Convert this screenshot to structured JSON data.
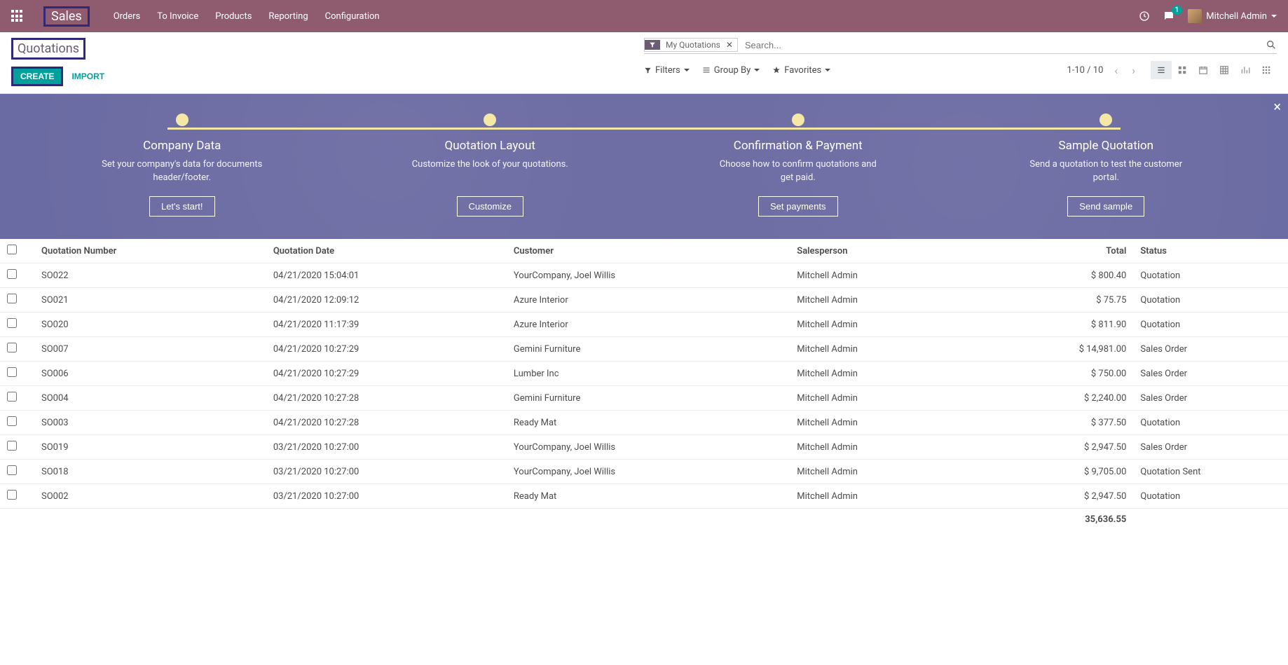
{
  "navbar": {
    "app_title": "Sales",
    "menu": [
      "Orders",
      "To Invoice",
      "Products",
      "Reporting",
      "Configuration"
    ],
    "messaging_badge": "1",
    "user_name": "Mitchell Admin"
  },
  "control_panel": {
    "breadcrumb": "Quotations",
    "create_label": "CREATE",
    "import_label": "IMPORT",
    "filter_chip": "My Quotations",
    "search_placeholder": "Search...",
    "filters_label": "Filters",
    "groupby_label": "Group By",
    "favorites_label": "Favorites",
    "pager_text": "1-10 / 10"
  },
  "onboarding": {
    "steps": [
      {
        "title": "Company Data",
        "desc": "Set your company's data for documents header/footer.",
        "button": "Let's start!"
      },
      {
        "title": "Quotation Layout",
        "desc": "Customize the look of your quotations.",
        "button": "Customize"
      },
      {
        "title": "Confirmation & Payment",
        "desc": "Choose how to confirm quotations and get paid.",
        "button": "Set payments"
      },
      {
        "title": "Sample Quotation",
        "desc": "Send a quotation to test the customer portal.",
        "button": "Send sample"
      }
    ]
  },
  "table": {
    "headers": {
      "quotation_number": "Quotation Number",
      "quotation_date": "Quotation Date",
      "customer": "Customer",
      "salesperson": "Salesperson",
      "total": "Total",
      "status": "Status"
    },
    "rows": [
      {
        "num": "SO022",
        "date": "04/21/2020 15:04:01",
        "customer": "YourCompany, Joel Willis",
        "salesperson": "Mitchell Admin",
        "total": "$ 800.40",
        "status": "Quotation"
      },
      {
        "num": "SO021",
        "date": "04/21/2020 12:09:12",
        "customer": "Azure Interior",
        "salesperson": "Mitchell Admin",
        "total": "$ 75.75",
        "status": "Quotation"
      },
      {
        "num": "SO020",
        "date": "04/21/2020 11:17:39",
        "customer": "Azure Interior",
        "salesperson": "Mitchell Admin",
        "total": "$ 811.90",
        "status": "Quotation"
      },
      {
        "num": "SO007",
        "date": "04/21/2020 10:27:29",
        "customer": "Gemini Furniture",
        "salesperson": "Mitchell Admin",
        "total": "$ 14,981.00",
        "status": "Sales Order"
      },
      {
        "num": "SO006",
        "date": "04/21/2020 10:27:29",
        "customer": "Lumber Inc",
        "salesperson": "Mitchell Admin",
        "total": "$ 750.00",
        "status": "Sales Order"
      },
      {
        "num": "SO004",
        "date": "04/21/2020 10:27:28",
        "customer": "Gemini Furniture",
        "salesperson": "Mitchell Admin",
        "total": "$ 2,240.00",
        "status": "Sales Order"
      },
      {
        "num": "SO003",
        "date": "04/21/2020 10:27:28",
        "customer": "Ready Mat",
        "salesperson": "Mitchell Admin",
        "total": "$ 377.50",
        "status": "Quotation"
      },
      {
        "num": "SO019",
        "date": "03/21/2020 10:27:00",
        "customer": "YourCompany, Joel Willis",
        "salesperson": "Mitchell Admin",
        "total": "$ 2,947.50",
        "status": "Sales Order"
      },
      {
        "num": "SO018",
        "date": "03/21/2020 10:27:00",
        "customer": "YourCompany, Joel Willis",
        "salesperson": "Mitchell Admin",
        "total": "$ 9,705.00",
        "status": "Quotation Sent"
      },
      {
        "num": "SO002",
        "date": "03/21/2020 10:27:00",
        "customer": "Ready Mat",
        "salesperson": "Mitchell Admin",
        "total": "$ 2,947.50",
        "status": "Quotation"
      }
    ],
    "footer_total": "35,636.55"
  }
}
